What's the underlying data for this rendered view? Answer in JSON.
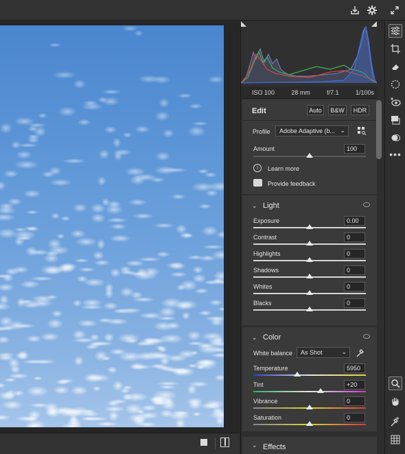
{
  "meta": {
    "iso": "ISO 100",
    "focal": "28 mm",
    "aperture": "f/7.1",
    "shutter": "1/100s"
  },
  "edit": {
    "title": "Edit",
    "auto": "Auto",
    "bw": "B&W",
    "hdr": "HDR"
  },
  "profile": {
    "label": "Profile",
    "value": "Adobe Adaptive (b...",
    "amount_label": "Amount",
    "amount_value": "100",
    "amount": 100
  },
  "links": {
    "learn_more": "Learn more",
    "feedback": "Provide feedback"
  },
  "light": {
    "title": "Light",
    "sliders": [
      {
        "label": "Exposure",
        "value": "0.00"
      },
      {
        "label": "Contrast",
        "value": "0"
      },
      {
        "label": "Highlights",
        "value": "0"
      },
      {
        "label": "Shadows",
        "value": "0"
      },
      {
        "label": "Whites",
        "value": "0"
      },
      {
        "label": "Blacks",
        "value": "0"
      }
    ]
  },
  "color": {
    "title": "Color",
    "wb_label": "White balance",
    "wb_value": "As Shot",
    "sliders": [
      {
        "label": "Temperature",
        "value": "5950",
        "position": 0.39
      },
      {
        "label": "Tint",
        "value": "+20",
        "position": 0.6
      },
      {
        "label": "Vibrance",
        "value": "0",
        "position": 0.5
      },
      {
        "label": "Saturation",
        "value": "0",
        "position": 0.5
      }
    ]
  },
  "effects": {
    "title": "Effects"
  },
  "icons": [
    "export-icon",
    "settings-gear-icon",
    "fullscreen-icon",
    "edit-sliders-icon",
    "crop-icon",
    "eraser-icon",
    "masking-icon",
    "redeye-icon",
    "presets-icon",
    "snapshots-icon",
    "more-icon",
    "zoom-icon",
    "hand-icon",
    "color-sampler-icon",
    "grid-icon"
  ],
  "colors": {
    "sky": "#5c95d6",
    "panel": "#3a3a3a",
    "histogram_blue": "#3d6fd6",
    "histogram_red": "#d24a3a",
    "histogram_green": "#3fb15a"
  }
}
